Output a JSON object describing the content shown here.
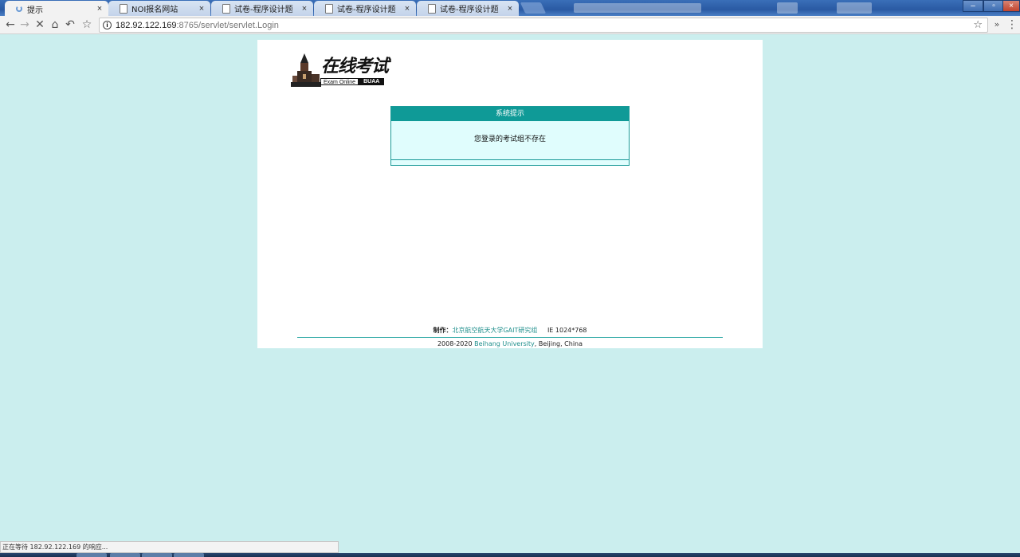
{
  "browser": {
    "tabs": [
      {
        "title": "提示",
        "active": true,
        "loading": true
      },
      {
        "title": "NOI报名网站",
        "active": false
      },
      {
        "title": "试卷-程序设计题",
        "active": false
      },
      {
        "title": "试卷-程序设计题",
        "active": false
      },
      {
        "title": "试卷-程序设计题",
        "active": false
      }
    ],
    "tab_close_glyph": "×",
    "address": {
      "host": "182.92.122.169",
      "path": ":8765/servlet/servlet.Login"
    },
    "status_text": "正在等待 182.92.122.169 的响应..."
  },
  "page": {
    "logo": {
      "title_cn": "在线考试",
      "subtitle_en": "Exam Online",
      "org": "BUAA"
    },
    "message_box": {
      "header": "系统提示",
      "message": "您登录的考试组不存在"
    },
    "footer": {
      "credit_label": "制作：",
      "credit_link": "北京航空航天大学GAIT研究组",
      "resolution": "IE 1024*768",
      "copyright_years": "2008-2020",
      "university_link": "Beihang University",
      "location": ", Beijing, China"
    }
  },
  "colors": {
    "page_background": "#cbeeee",
    "accent_teal": "#0f9a97",
    "message_background": "#e0fdfd",
    "link_color": "#1f8f8c"
  }
}
